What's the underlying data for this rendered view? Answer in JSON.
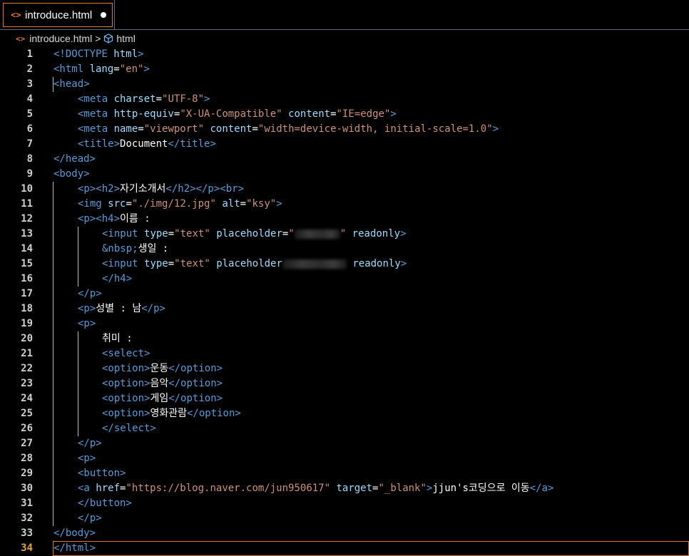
{
  "tab": {
    "filename": "introduce.html",
    "icon": "code-icon"
  },
  "breadcrumb": {
    "file": "introduce.html",
    "separator": ">",
    "symbol": "html",
    "symbol_icon": "cube-icon"
  },
  "colors": {
    "accent": "#e07b2a",
    "tag": "#569cd6",
    "attribute": "#9cdcfe",
    "string": "#ce9178",
    "text": "#ffffff"
  },
  "current_line": 34,
  "lines": [
    {
      "n": "1",
      "indent": 0,
      "tokens": [
        [
          "tg",
          "<!DOCTYPE "
        ],
        [
          "at",
          "html"
        ],
        [
          "tg",
          ">"
        ]
      ]
    },
    {
      "n": "2",
      "indent": 0,
      "tokens": [
        [
          "tg",
          "<html "
        ],
        [
          "at",
          "lang"
        ],
        [
          "tx",
          "="
        ],
        [
          "st",
          "\"en\""
        ],
        [
          "tg",
          ">"
        ]
      ]
    },
    {
      "n": "3",
      "indent": 0,
      "tokens": [
        [
          "tg",
          "<head>"
        ]
      ]
    },
    {
      "n": "4",
      "indent": 1,
      "tokens": [
        [
          "tg",
          "<meta "
        ],
        [
          "at",
          "charset"
        ],
        [
          "tx",
          "="
        ],
        [
          "st",
          "\"UTF-8\""
        ],
        [
          "tg",
          ">"
        ]
      ]
    },
    {
      "n": "5",
      "indent": 1,
      "tokens": [
        [
          "tg",
          "<meta "
        ],
        [
          "at",
          "http-equiv"
        ],
        [
          "tx",
          "="
        ],
        [
          "st",
          "\"X-UA-Compatible\""
        ],
        [
          "tx",
          " "
        ],
        [
          "at",
          "content"
        ],
        [
          "tx",
          "="
        ],
        [
          "st",
          "\"IE=edge\""
        ],
        [
          "tg",
          ">"
        ]
      ]
    },
    {
      "n": "6",
      "indent": 1,
      "tokens": [
        [
          "tg",
          "<meta "
        ],
        [
          "at",
          "name"
        ],
        [
          "tx",
          "="
        ],
        [
          "st",
          "\"viewport\""
        ],
        [
          "tx",
          " "
        ],
        [
          "at",
          "content"
        ],
        [
          "tx",
          "="
        ],
        [
          "st",
          "\"width=device-width, initial-scale=1.0\""
        ],
        [
          "tg",
          ">"
        ]
      ]
    },
    {
      "n": "7",
      "indent": 1,
      "tokens": [
        [
          "tg",
          "<title>"
        ],
        [
          "tx",
          "Document"
        ],
        [
          "tg",
          "</title>"
        ]
      ]
    },
    {
      "n": "8",
      "indent": 0,
      "tokens": [
        [
          "tg",
          "</head>"
        ]
      ]
    },
    {
      "n": "9",
      "indent": 0,
      "tokens": [
        [
          "tg",
          "<body>"
        ]
      ]
    },
    {
      "n": "10",
      "indent": 1,
      "tokens": [
        [
          "tg",
          "<p><h2>"
        ],
        [
          "tx",
          "자기소개서"
        ],
        [
          "tg",
          "</h2></p><br>"
        ]
      ]
    },
    {
      "n": "11",
      "indent": 1,
      "tokens": [
        [
          "tg",
          "<img "
        ],
        [
          "at",
          "src"
        ],
        [
          "tx",
          "="
        ],
        [
          "st",
          "\"./img/12.jpg\""
        ],
        [
          "tx",
          " "
        ],
        [
          "at",
          "alt"
        ],
        [
          "tx",
          "="
        ],
        [
          "st",
          "\"ksy\""
        ],
        [
          "tg",
          ">"
        ]
      ]
    },
    {
      "n": "12",
      "indent": 1,
      "tokens": [
        [
          "tg",
          "<p><h4>"
        ],
        [
          "tx",
          "이름 :"
        ]
      ]
    },
    {
      "n": "13",
      "indent": 2,
      "tokens": [
        [
          "tg",
          "<input "
        ],
        [
          "at",
          "type"
        ],
        [
          "tx",
          "="
        ],
        [
          "st",
          "\"text\""
        ],
        [
          "tx",
          " "
        ],
        [
          "at",
          "placeholder"
        ],
        [
          "tx",
          "="
        ],
        [
          "st",
          "\""
        ],
        [
          "blur",
          ""
        ],
        [
          "st",
          "\""
        ],
        [
          "tx",
          " "
        ],
        [
          "at",
          "readonly"
        ],
        [
          "tg",
          ">"
        ]
      ]
    },
    {
      "n": "14",
      "indent": 2,
      "tokens": [
        [
          "en",
          "&nbsp;"
        ],
        [
          "tx",
          "생일 :"
        ]
      ]
    },
    {
      "n": "15",
      "indent": 2,
      "tokens": [
        [
          "tg",
          "<input "
        ],
        [
          "at",
          "type"
        ],
        [
          "tx",
          "="
        ],
        [
          "st",
          "\"text\""
        ],
        [
          "tx",
          " "
        ],
        [
          "at",
          "placeholder"
        ],
        [
          "blur2",
          ""
        ],
        [
          "tx",
          " "
        ],
        [
          "at",
          "readonly"
        ],
        [
          "tg",
          ">"
        ]
      ]
    },
    {
      "n": "16",
      "indent": 2,
      "tokens": [
        [
          "tg",
          "</h4>"
        ]
      ]
    },
    {
      "n": "17",
      "indent": 1,
      "tokens": [
        [
          "tg",
          "</p>"
        ]
      ]
    },
    {
      "n": "18",
      "indent": 1,
      "tokens": [
        [
          "tg",
          "<p>"
        ],
        [
          "tx",
          "성별 : 남"
        ],
        [
          "tg",
          "</p>"
        ]
      ]
    },
    {
      "n": "19",
      "indent": 1,
      "tokens": [
        [
          "tg",
          "<p>"
        ]
      ]
    },
    {
      "n": "20",
      "indent": 2,
      "tokens": [
        [
          "tx",
          "취미 :"
        ]
      ]
    },
    {
      "n": "21",
      "indent": 2,
      "tokens": [
        [
          "tg",
          "<select>"
        ]
      ]
    },
    {
      "n": "22",
      "indent": 2,
      "tokens": [
        [
          "tg",
          "<option>"
        ],
        [
          "tx",
          "운동"
        ],
        [
          "tg",
          "</option>"
        ]
      ]
    },
    {
      "n": "23",
      "indent": 2,
      "tokens": [
        [
          "tg",
          "<option>"
        ],
        [
          "tx",
          "음악"
        ],
        [
          "tg",
          "</option>"
        ]
      ]
    },
    {
      "n": "24",
      "indent": 2,
      "tokens": [
        [
          "tg",
          "<option>"
        ],
        [
          "tx",
          "게임"
        ],
        [
          "tg",
          "</option>"
        ]
      ]
    },
    {
      "n": "25",
      "indent": 2,
      "tokens": [
        [
          "tg",
          "<option>"
        ],
        [
          "tx",
          "영화관람"
        ],
        [
          "tg",
          "</option>"
        ]
      ]
    },
    {
      "n": "26",
      "indent": 2,
      "tokens": [
        [
          "tg",
          "</select>"
        ]
      ]
    },
    {
      "n": "27",
      "indent": 1,
      "tokens": [
        [
          "tg",
          "</p>"
        ]
      ]
    },
    {
      "n": "28",
      "indent": 1,
      "tokens": [
        [
          "tg",
          "<p>"
        ]
      ]
    },
    {
      "n": "29",
      "indent": 1,
      "tokens": [
        [
          "tg",
          "<button>"
        ]
      ]
    },
    {
      "n": "30",
      "indent": 1,
      "tokens": [
        [
          "tg",
          "<a "
        ],
        [
          "at",
          "href"
        ],
        [
          "tx",
          "="
        ],
        [
          "st",
          "\"https://blog.naver.com/jun950617\""
        ],
        [
          "tx",
          " "
        ],
        [
          "at",
          "target"
        ],
        [
          "tx",
          "="
        ],
        [
          "st",
          "\"_blank\""
        ],
        [
          "tg",
          ">"
        ],
        [
          "tx",
          "jjun's코딩으로 이동"
        ],
        [
          "tg",
          "</a>"
        ]
      ]
    },
    {
      "n": "31",
      "indent": 1,
      "tokens": [
        [
          "tg",
          "</button>"
        ]
      ]
    },
    {
      "n": "32",
      "indent": 1,
      "tokens": [
        [
          "tg",
          "</p>"
        ]
      ]
    },
    {
      "n": "33",
      "indent": 0,
      "tokens": [
        [
          "tg",
          "</body>"
        ]
      ]
    },
    {
      "n": "34",
      "indent": 0,
      "tokens": [
        [
          "tg",
          "</html>"
        ]
      ]
    }
  ]
}
